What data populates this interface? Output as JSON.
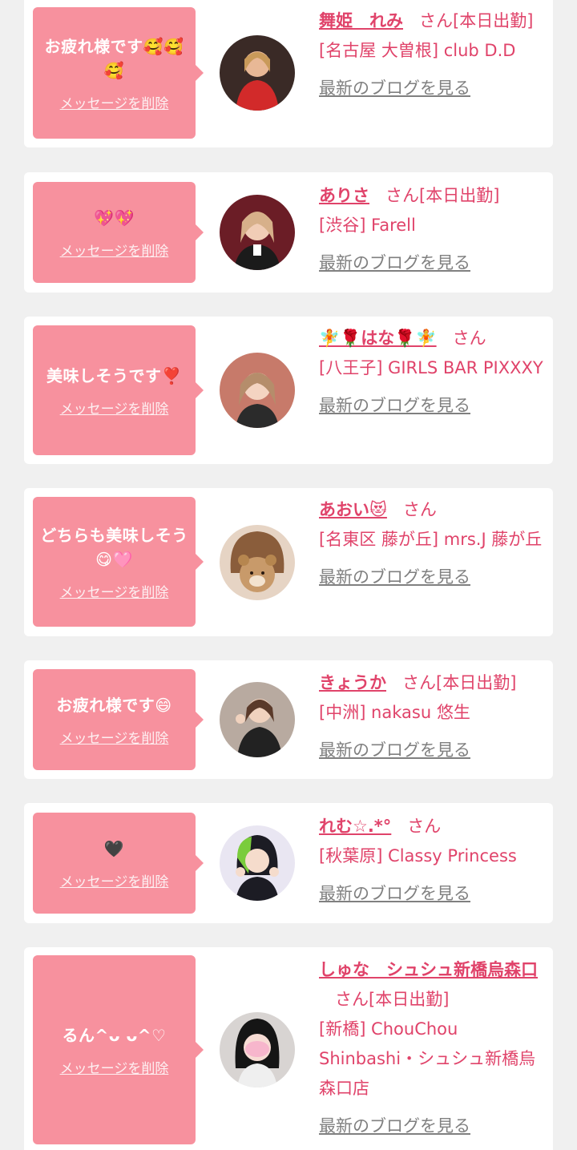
{
  "colors": {
    "background": "#f0f0f0",
    "card": "#ffffff",
    "bubble": "#f7919e",
    "accent_text": "#e0436a",
    "link_gray": "#808080"
  },
  "delete_label": "メッセージを削除",
  "blog_label": "最新のブログを見る",
  "items": [
    {
      "message": "お疲れ様です🥰🥰🥰",
      "name": "舞姫　れみ",
      "suffix": "さん[本日出勤]",
      "shop": "[名古屋 大曽根] club D.D",
      "avatar_icon": "avatar-photo"
    },
    {
      "message": "💖💖",
      "name": "ありさ",
      "suffix": "さん[本日出勤]",
      "shop": "[渋谷] Farell",
      "avatar_icon": "avatar-photo"
    },
    {
      "message": "美味しそうです❣️",
      "name": "🧚🌹はな🌹🧚",
      "suffix": "さん",
      "shop": "[八王子] GIRLS BAR PIXXXY",
      "avatar_icon": "avatar-photo"
    },
    {
      "message": "どちらも美味しそう😋🩷",
      "name": "あおい😻",
      "suffix": "さん",
      "shop": "[名東区 藤が丘] mrs.J 藤が丘",
      "avatar_icon": "avatar-photo"
    },
    {
      "message": "お疲れ様です😄",
      "name": "きょうか",
      "suffix": "さん[本日出勤]",
      "shop": "[中洲] nakasu 悠生",
      "avatar_icon": "avatar-photo"
    },
    {
      "message": "🖤",
      "name": "れむ☆.*°",
      "suffix": "さん",
      "shop": "[秋葉原] Classy Princess",
      "avatar_icon": "avatar-photo"
    },
    {
      "message": "るん^ᴗ ᴗ^♡",
      "name": "しゅな　シュシュ新橋烏森口",
      "suffix": "さん[本日出勤]",
      "shop": "[新橋] ChouChou Shinbashi・シュシュ新橋烏森口店",
      "avatar_icon": "avatar-photo"
    }
  ]
}
